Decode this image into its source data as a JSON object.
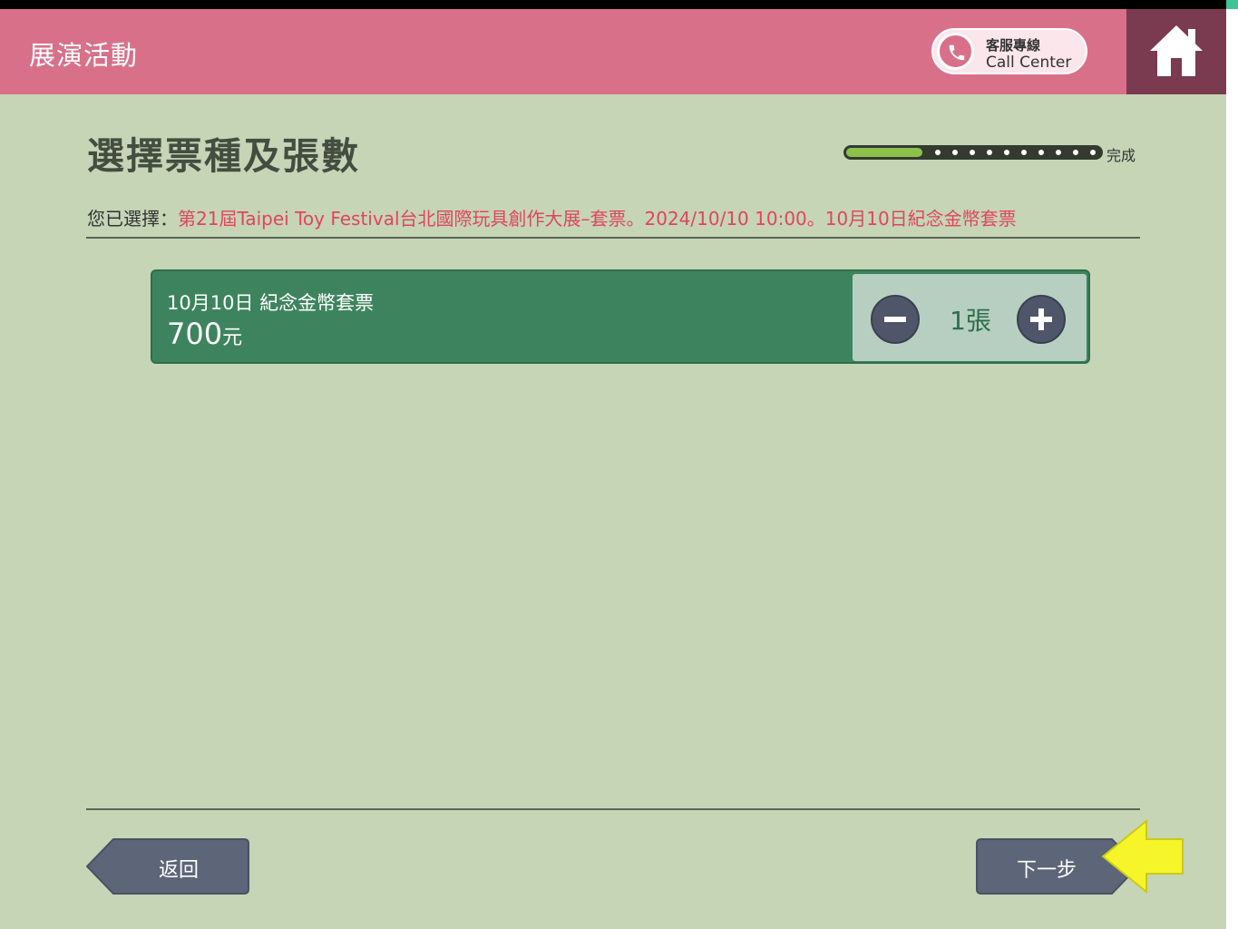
{
  "header": {
    "title": "展演活動",
    "call_center_line1": "客服專線",
    "call_center_line2": "Call Center",
    "home_icon": "home-icon",
    "phone_icon": "phone-icon"
  },
  "page": {
    "title": "選擇票種及張數",
    "progress_label": "完成",
    "selected_prefix": "您已選擇：",
    "selected_value": "第21屆Taipei Toy Festival台北國際玩具創作大展–套票。2024/10/10 10:00。10月10日紀念金幣套票"
  },
  "ticket": {
    "name": "10月10日 紀念金幣套票",
    "price": "700",
    "price_unit": "元",
    "quantity": "1張"
  },
  "footer": {
    "back_label": "返回",
    "next_label": "下一步"
  },
  "colors": {
    "header_bg": "#d9708a",
    "home_bg": "#7a3a4f",
    "page_bg": "#c5d5b6",
    "ticket_bg": "#3d845e",
    "highlight_text": "#e0455c",
    "button_bg": "#5d6578",
    "hint_arrow": "#f5f52a"
  }
}
